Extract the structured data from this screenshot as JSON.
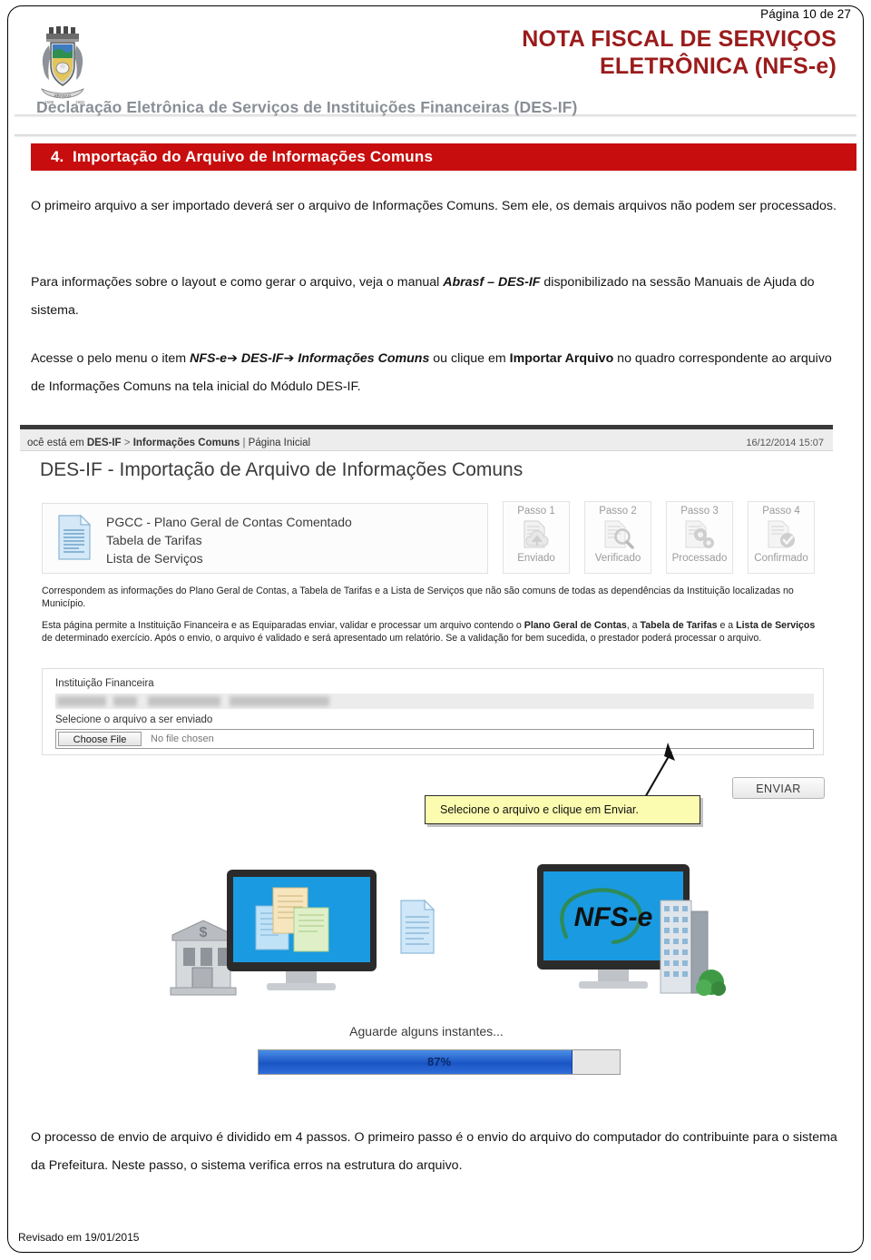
{
  "page": {
    "number_label": "Página 10 de 27",
    "footer": "Revisado em 19/01/2015"
  },
  "header": {
    "crest_icon": "municipal-coat-of-arms",
    "title_line1": "NOTA FISCAL DE SERVIÇOS",
    "title_line2": "ELETRÔNICA (NFS-e)",
    "subtitle": "Declaração Eletrônica de Serviços de Instituições Financeiras (DES-IF)",
    "title_color": "#9b1b1b",
    "subtitle_color": "#8a8f96"
  },
  "section": {
    "number": "4.",
    "title": "Importação do Arquivo de Informações Comuns",
    "bar_color": "#c70d0d"
  },
  "paragraphs": {
    "p1_a": "O primeiro arquivo a ser importado deverá ser o arquivo de Informações Comuns. Sem ele, os demais arquivos não podem ser processados.",
    "p2_a": "Para informações sobre o layout e como gerar o arquivo, veja o manual ",
    "p2_b": "Abrasf – DES-IF",
    "p2_c": " disponibilizado na sessão Manuais de Ajuda do sistema.",
    "p3_a": "Acesse o pelo menu o item ",
    "p3_b": "NFS-e",
    "p3_arrow1": "➔",
    "p3_c": "DES-IF",
    "p3_arrow2": "➔",
    "p3_d": "Informações Comuns",
    "p3_e": " ou clique em ",
    "p3_f": "Importar Arquivo",
    "p3_g": " no quadro correspondente ao arquivo de Informações Comuns na tela inicial do Módulo DES-IF.",
    "bottom": "O processo de envio de arquivo é dividido em 4 passos. O primeiro passo é o envio do arquivo do computador do contribuinte para o sistema da Prefeitura. Neste passo, o sistema verifica erros na estrutura do arquivo."
  },
  "screenshot": {
    "breadcrumb_prefix": "ocê está em",
    "breadcrumb_module": "DES-IF",
    "breadcrumb_sep1": ">",
    "breadcrumb_section": "Informações Comuns",
    "breadcrumb_sep2": "|",
    "breadcrumb_page": "Página Inicial",
    "timestamp": "16/12/2014 15:07",
    "heading": "DES-IF - Importação de Arquivo de Informações Comuns",
    "doc_panel": {
      "icon": "document-icon",
      "line1": "PGCC - Plano Geral de Contas Comentado",
      "line2": "Tabela de Tarifas",
      "line3": "Lista de Serviços"
    },
    "steps": [
      {
        "top": "Passo 1",
        "bottom": "Enviado",
        "icon": "cloud-upload-icon"
      },
      {
        "top": "Passo 2",
        "bottom": "Verificado",
        "icon": "magnifier-document-icon"
      },
      {
        "top": "Passo 3",
        "bottom": "Processado",
        "icon": "gears-document-icon"
      },
      {
        "top": "Passo 4",
        "bottom": "Confirmado",
        "icon": "check-document-icon"
      }
    ],
    "desc1": "Correspondem as informações do Plano Geral de Contas, a Tabela de Tarifas e a Lista de Serviços que não são comuns de todas as dependências da Instituição localizadas no Município.",
    "desc2_a": "Esta página permite a Instituição Financeira e as Equiparadas enviar, validar e processar um arquivo contendo o ",
    "desc2_b": "Plano Geral de Contas",
    "desc2_c": ", a ",
    "desc2_d": "Tabela de Tarifas",
    "desc2_e": " e a ",
    "desc2_f": "Lista de Serviços",
    "desc2_g": " de determinado exercício. Após o envio, o arquivo é validado e será apresentado um relatório. Se a validação for bem sucedida, o prestador poderá processar o arquivo.",
    "form": {
      "institution_label": "Instituição Financeira",
      "institution_value": "",
      "file_label": "Selecione o arquivo a ser enviado",
      "choose_button": "Choose File",
      "file_placeholder": "No file chosen"
    },
    "callout": "Selecione o arquivo e clique em Enviar.",
    "callout_bg": "#fcfcb0",
    "send_button": "ENVIAR",
    "illustration": {
      "bank_icon": "bank-building-icon",
      "monitor_left_icon": "monitor-with-documents-icon",
      "transfer_doc_icon": "document-icon",
      "monitor_right_icon": "monitor-nfse-icon",
      "city_icon": "city-building-icon",
      "nfse_logo_text": "NFS-e",
      "screen_color": "#1a9ae0"
    },
    "progress": {
      "label": "Aguarde alguns instantes...",
      "percent": 87,
      "percent_label": "87%",
      "fill_color": "#2f6edb"
    }
  }
}
